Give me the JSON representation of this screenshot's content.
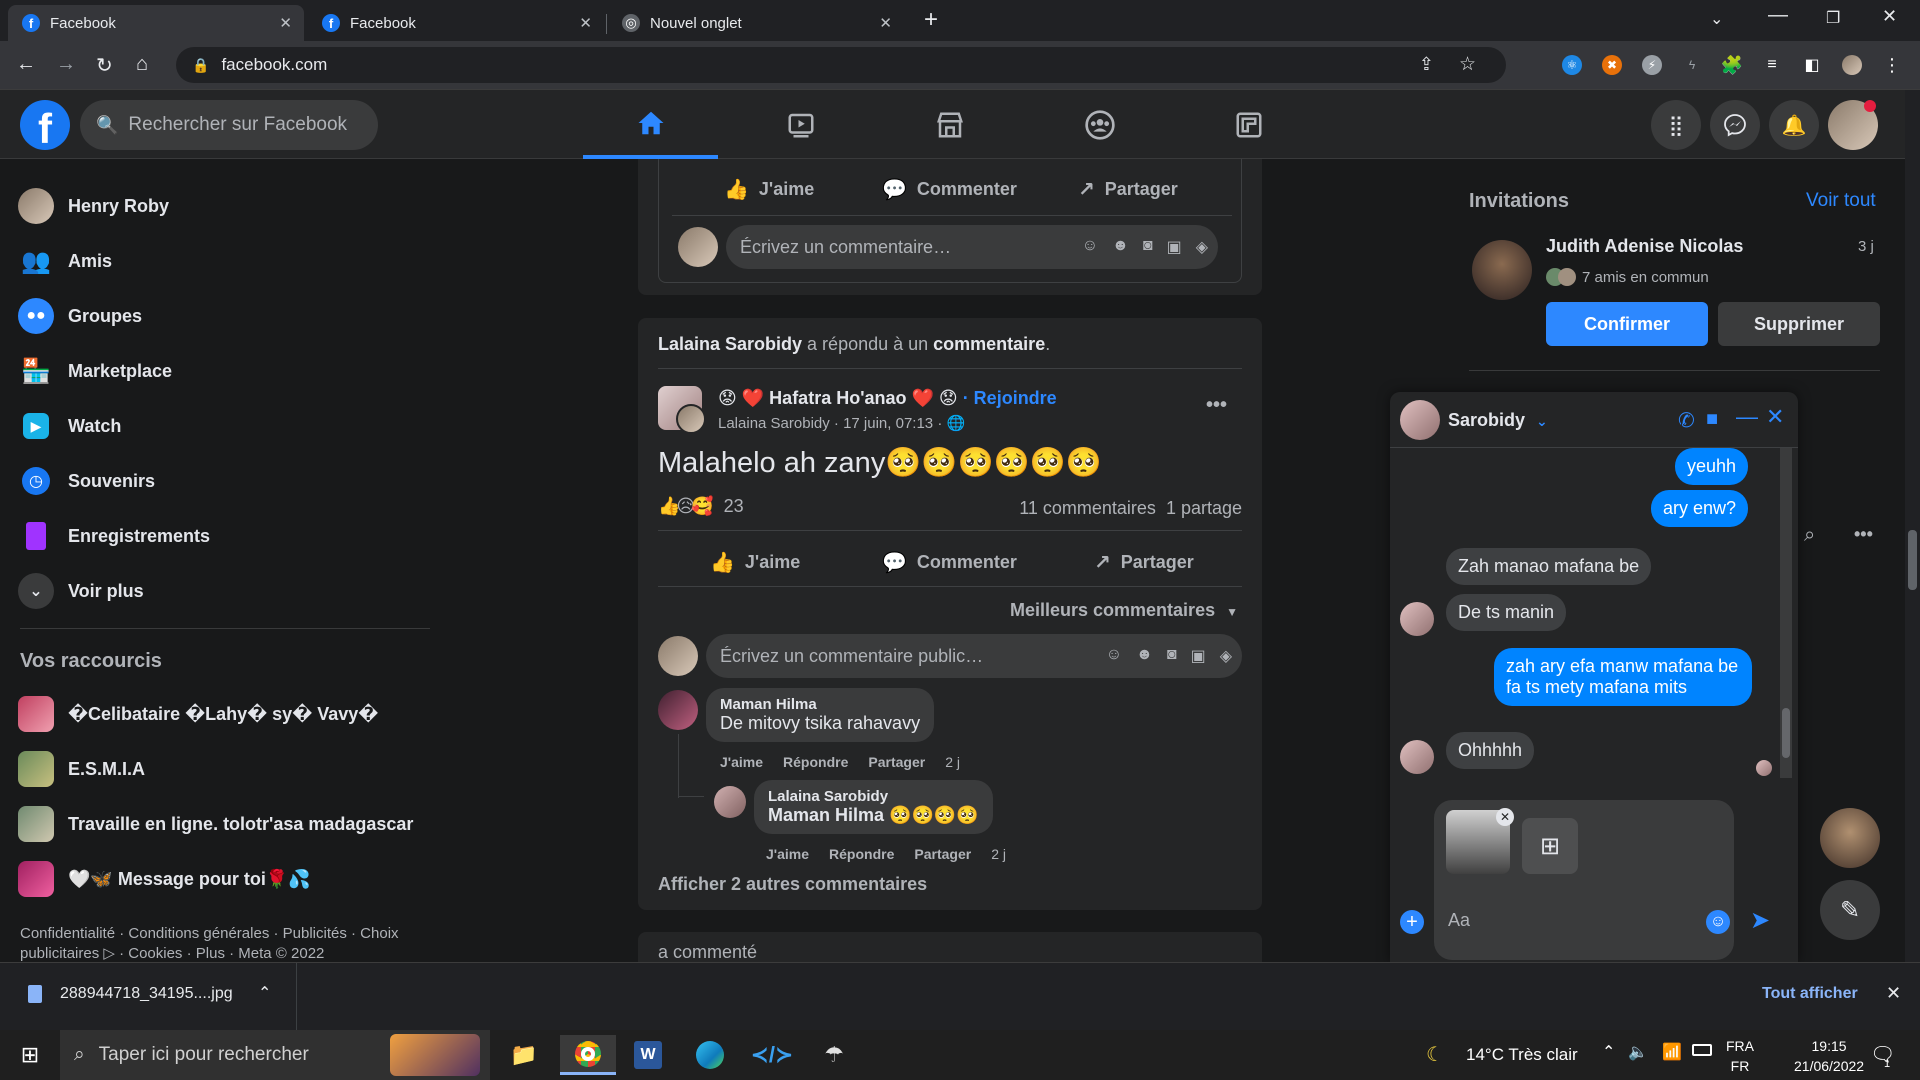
{
  "browser": {
    "tabs": [
      {
        "title": "Facebook"
      },
      {
        "title": "Facebook"
      },
      {
        "title": "Nouvel onglet"
      }
    ],
    "url": "facebook.com"
  },
  "header": {
    "search_placeholder": "Rechercher sur Facebook"
  },
  "sidebar": {
    "items": [
      {
        "label": "Henry Roby"
      },
      {
        "label": "Amis"
      },
      {
        "label": "Groupes"
      },
      {
        "label": "Marketplace"
      },
      {
        "label": "Watch"
      },
      {
        "label": "Souvenirs"
      },
      {
        "label": "Enregistrements"
      },
      {
        "label": "Voir plus"
      }
    ],
    "shortcuts_title": "Vos raccourcis",
    "shortcuts": [
      {
        "label": "�Celibataire �Lahy� sy� Vavy�"
      },
      {
        "label": "E.S.M.I.A"
      },
      {
        "label": "Travaille en ligne. tolotr'asa madagascar"
      },
      {
        "label": "🤍🦋 Message pour toi🌹💦"
      }
    ],
    "footer_line1": "Confidentialité · Conditions générales · Publicités · Choix",
    "footer_line2": "publicitaires ▷ · Cookies · Plus · Meta © 2022"
  },
  "feed": {
    "post1": {
      "like": "J'aime",
      "comment": "Commenter",
      "share": "Partager",
      "comment_placeholder": "Écrivez un commentaire…"
    },
    "post2": {
      "activity_name": "Lalaina Sarobidy",
      "activity_text": " a répondu à un ",
      "activity_target": "commentaire",
      "activity_end": ".",
      "group_name": "😟 ❤️ Hafatra Ho'anao ❤️ 😟",
      "join": "· Rejoindre",
      "author_meta": "Lalaina Sarobidy · 17 juin, 07:13 · 🌐",
      "text": "Malahelo ah zany🥺🥺🥺🥺🥺🥺",
      "reaction_icons": "👍😥🥰",
      "reaction_count": "23",
      "comments_count": "11 commentaires",
      "shares_count": "1 partage",
      "like": "J'aime",
      "comment": "Commenter",
      "share": "Partager",
      "sort_label": "Meilleurs commentaires",
      "comment_placeholder": "Écrivez un commentaire public…",
      "comments": [
        {
          "name": "Maman Hilma",
          "text": "De mitovy tsika rahavavy",
          "like": "J'aime",
          "reply": "Répondre",
          "share": "Partager",
          "time": "2 j"
        },
        {
          "name": "Lalaina Sarobidy",
          "text": "Maman Hilma 🥺🥺🥺🥺",
          "like": "J'aime",
          "reply": "Répondre",
          "share": "Partager",
          "time": "2 j"
        }
      ],
      "more_comments": "Afficher 2 autres commentaires"
    },
    "post3_partial": "a commenté"
  },
  "right": {
    "invitations_title": "Invitations",
    "see_all": "Voir tout",
    "invite_name": "Judith Adenise Nicolas",
    "invite_time": "3 j",
    "mutual": "7 amis en commun",
    "confirm": "Confirmer",
    "delete": "Supprimer"
  },
  "messenger": {
    "contact": "Sarobidy",
    "messages": [
      {
        "from": "me",
        "text": "yeuhh"
      },
      {
        "from": "me",
        "text": "ary enw?"
      },
      {
        "from": "them",
        "text": "Zah manao mafana be"
      },
      {
        "from": "them",
        "text": "De ts manin"
      },
      {
        "from": "me",
        "text": "zah ary efa manw mafana be fa ts mety mafana mits"
      },
      {
        "from": "them",
        "text": "Ohhhhh"
      }
    ],
    "input_placeholder": "Aa"
  },
  "download": {
    "filename": "288944718_34195....jpg",
    "show_all": "Tout afficher"
  },
  "taskbar": {
    "search_placeholder": "Taper ici pour rechercher",
    "weather": "14°C  Très clair",
    "lang1": "FRA",
    "lang2": "FR",
    "time": "19:15",
    "date": "21/06/2022",
    "notif_count": "1"
  },
  "colors": {
    "accent": "#2d88ff",
    "messenger_blue": "#0084ff",
    "bg": "#18191a",
    "card": "#242526"
  }
}
